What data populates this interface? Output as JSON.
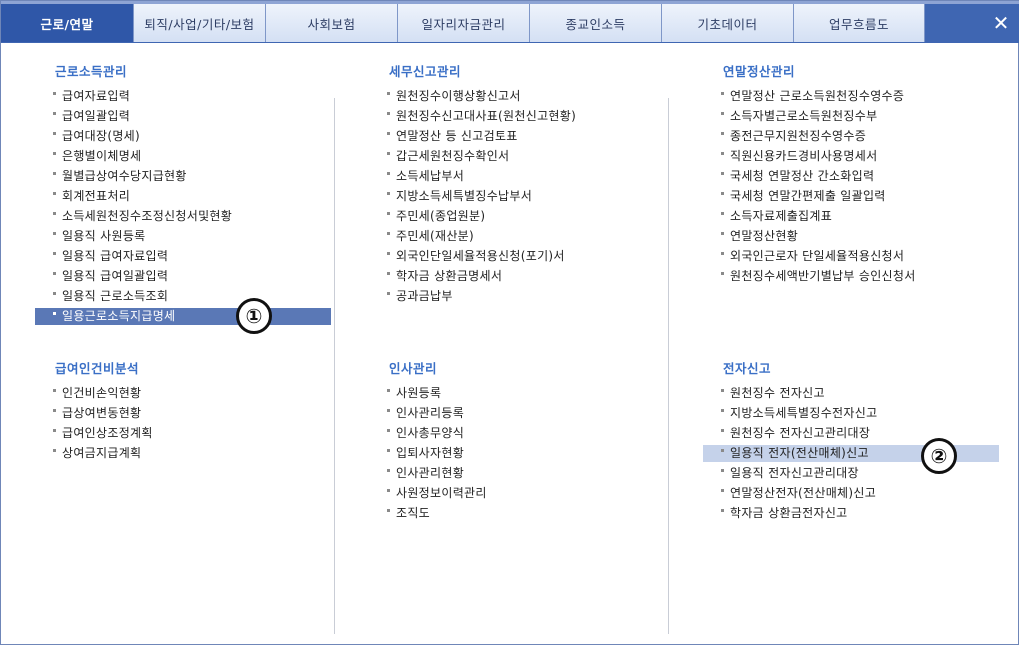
{
  "tabs": [
    {
      "label": "근로/연말",
      "active": true
    },
    {
      "label": "퇴직/사업/기타/보험",
      "active": false
    },
    {
      "label": "사회보험",
      "active": false
    },
    {
      "label": "일자리자금관리",
      "active": false
    },
    {
      "label": "종교인소득",
      "active": false
    },
    {
      "label": "기초데이터",
      "active": false
    },
    {
      "label": "업무흐름도",
      "active": false
    }
  ],
  "close_label": "✕",
  "sections": {
    "earned_income": {
      "title": "근로소득관리",
      "items": [
        "급여자료입력",
        "급여일괄입력",
        "급여대장(명세)",
        "은행별이체명세",
        "월별급상여수당지급현황",
        "회계전표처리",
        "소득세원천징수조정신청서및현황",
        "일용직 사원등록",
        "일용직 급여자료입력",
        "일용직 급여일괄입력",
        "일용직 근로소득조회",
        "일용근로소득지급명세"
      ]
    },
    "tax_report": {
      "title": "세무신고관리",
      "items": [
        "원천징수이행상황신고서",
        "원천징수신고대사표(원천신고현황)",
        "연말정산 등 신고검토표",
        "갑근세원천징수확인서",
        "소득세납부서",
        "지방소득세특별징수납부서",
        "주민세(종업원분)",
        "주민세(재산분)",
        "외국인단일세율적용신청(포기)서",
        "학자금 상환금명세서",
        "공과금납부"
      ]
    },
    "year_end": {
      "title": "연말정산관리",
      "items": [
        "연말정산 근로소득원천징수영수증",
        "소득자별근로소득원천징수부",
        "종전근무지원천징수영수증",
        "직원신용카드경비사용명세서",
        "국세청 연말정산 간소화입력",
        "국세청 연말간편제출 일괄입력",
        "소득자료제출집계표",
        "연말정산현황",
        "외국인근로자 단일세율적용신청서",
        "원천징수세액반기별납부 승인신청서"
      ]
    },
    "payroll_analysis": {
      "title": "급여인건비분석",
      "items": [
        "인건비손익현황",
        "급상여변동현황",
        "급여인상조정계획",
        "상여금지급계획"
      ]
    },
    "hr": {
      "title": "인사관리",
      "items": [
        "사원등록",
        "인사관리등록",
        "인사총무양식",
        "입퇴사자현황",
        "인사관리현황",
        "사원정보이력관리",
        "조직도"
      ]
    },
    "e_filing": {
      "title": "전자신고",
      "items": [
        "원천징수 전자신고",
        "지방소득세특별징수전자신고",
        "원천징수 전자신고관리대장",
        "일용직 전자(전산매체)신고",
        "일용직 전자신고관리대장",
        "연말정산전자(전산매체)신고",
        "학자금 상환금전자신고"
      ]
    }
  },
  "markers": {
    "one": "①",
    "two": "②"
  }
}
